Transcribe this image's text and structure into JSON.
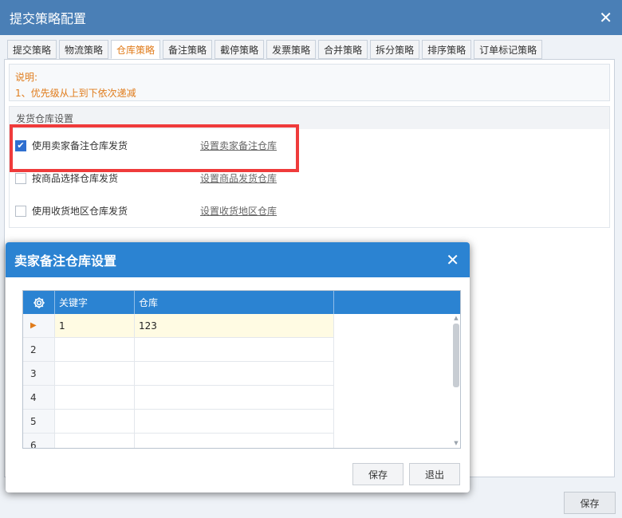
{
  "main": {
    "title": "提交策略配置",
    "tabs": [
      {
        "label": "提交策略"
      },
      {
        "label": "物流策略"
      },
      {
        "label": "仓库策略",
        "active": true
      },
      {
        "label": "备注策略"
      },
      {
        "label": "截停策略"
      },
      {
        "label": "发票策略"
      },
      {
        "label": "合并策略"
      },
      {
        "label": "拆分策略"
      },
      {
        "label": "排序策略"
      },
      {
        "label": "订单标记策略"
      }
    ],
    "note": {
      "heading": "说明:",
      "line1": "1、优先级从上到下依次递减"
    },
    "section_title": "发货仓库设置",
    "options": [
      {
        "label": "使用卖家备注仓库发货",
        "checked": true,
        "link": "设置卖家备注仓库"
      },
      {
        "label": "按商品选择仓库发货",
        "checked": false,
        "link": "设置商品发货仓库"
      },
      {
        "label": "使用收货地区仓库发货",
        "checked": false,
        "link": "设置收货地区仓库"
      }
    ],
    "save_label": "保存"
  },
  "dialog": {
    "title": "卖家备注仓库设置",
    "columns": [
      "关键字",
      "仓库"
    ],
    "rows": [
      {
        "num": "",
        "keyword": "1",
        "warehouse": "123",
        "selected": true
      },
      {
        "num": "2",
        "keyword": "",
        "warehouse": ""
      },
      {
        "num": "3",
        "keyword": "",
        "warehouse": ""
      },
      {
        "num": "4",
        "keyword": "",
        "warehouse": ""
      },
      {
        "num": "5",
        "keyword": "",
        "warehouse": ""
      },
      {
        "num": "6",
        "keyword": "",
        "warehouse": ""
      }
    ],
    "save_label": "保存",
    "exit_label": "退出"
  },
  "icons": {
    "close": "close-icon",
    "settings": "gear-icon",
    "row_pointer": "play-arrow-icon",
    "checkmark": "check-icon"
  },
  "colors": {
    "title_bar": "#4a7fb6",
    "dialog_title_bar": "#2b83d2",
    "accent_orange": "#e07b1a",
    "highlight_red": "#ef3b3b",
    "checkbox_blue": "#2f6fd0"
  }
}
